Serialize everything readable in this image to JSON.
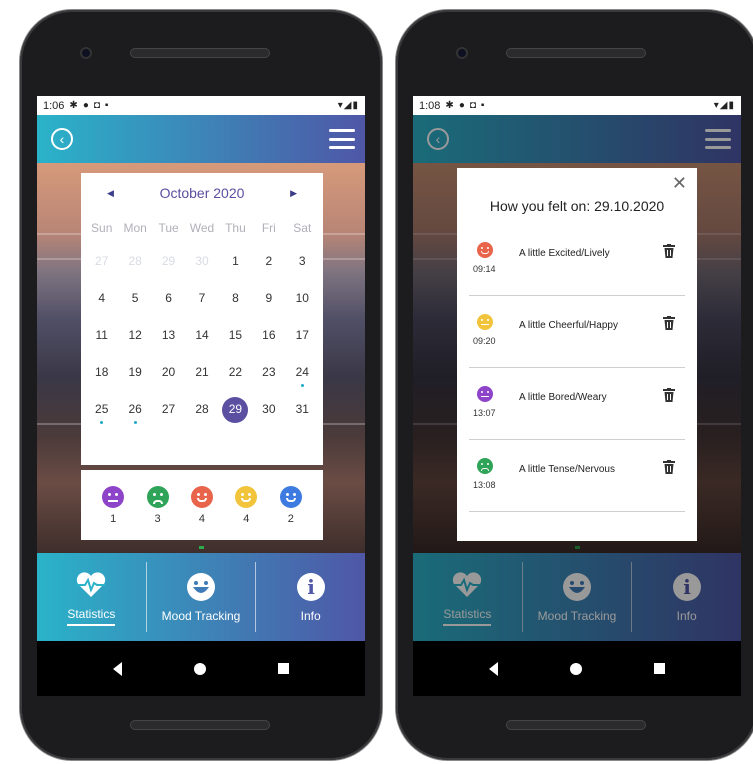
{
  "colors": {
    "accent": "#5a4fa0",
    "gradient_start": "#2ab3c9",
    "gradient_end": "#4f57a6",
    "mood_bored": "#8e44c9",
    "mood_tense": "#2fa358",
    "mood_excited": "#e8644a",
    "mood_cheerful": "#f2c43c",
    "mood_calm": "#3d7be0",
    "event_dot": "#22a8c9"
  },
  "left_screen": {
    "status_time": "1:06",
    "calendar": {
      "month_label": "October 2020",
      "prev_icon": "chevron-left-icon",
      "next_icon": "chevron-right-icon",
      "weekdays": [
        "Sun",
        "Mon",
        "Tue",
        "Wed",
        "Thu",
        "Fri",
        "Sat"
      ],
      "days": [
        {
          "n": "27",
          "muted": true
        },
        {
          "n": "28",
          "muted": true
        },
        {
          "n": "29",
          "muted": true
        },
        {
          "n": "30",
          "muted": true
        },
        {
          "n": "1"
        },
        {
          "n": "2"
        },
        {
          "n": "3"
        },
        {
          "n": "4"
        },
        {
          "n": "5"
        },
        {
          "n": "6"
        },
        {
          "n": "7"
        },
        {
          "n": "8"
        },
        {
          "n": "9"
        },
        {
          "n": "10"
        },
        {
          "n": "11"
        },
        {
          "n": "12"
        },
        {
          "n": "13"
        },
        {
          "n": "14"
        },
        {
          "n": "15"
        },
        {
          "n": "16"
        },
        {
          "n": "17"
        },
        {
          "n": "18"
        },
        {
          "n": "19"
        },
        {
          "n": "20"
        },
        {
          "n": "21"
        },
        {
          "n": "22"
        },
        {
          "n": "23"
        },
        {
          "n": "24",
          "dot": true
        },
        {
          "n": "25",
          "dot": true
        },
        {
          "n": "26",
          "dot": true
        },
        {
          "n": "27"
        },
        {
          "n": "28"
        },
        {
          "n": "29",
          "selected": true
        },
        {
          "n": "30"
        },
        {
          "n": "31"
        }
      ]
    },
    "mood_summary": [
      {
        "mood": "bored",
        "face": "flat",
        "color": "#8e44c9",
        "count": "1"
      },
      {
        "mood": "tense",
        "face": "sad",
        "color": "#2fa358",
        "count": "3"
      },
      {
        "mood": "excited",
        "face": "happy",
        "color": "#e8644a",
        "count": "4"
      },
      {
        "mood": "cheerful",
        "face": "happy",
        "color": "#f2c43c",
        "count": "4"
      },
      {
        "mood": "calm",
        "face": "happy",
        "color": "#3d7be0",
        "count": "2"
      }
    ]
  },
  "right_screen": {
    "status_time": "1:08",
    "dialog": {
      "title": "How you felt on: 29.10.2020",
      "entries": [
        {
          "time": "09:14",
          "label": "A little Excited/Lively",
          "face": "happy",
          "color": "#e8644a"
        },
        {
          "time": "09:20",
          "label": "A little Cheerful/Happy",
          "face": "flat",
          "color": "#f2c43c"
        },
        {
          "time": "13:07",
          "label": "A little Bored/Weary",
          "face": "flat",
          "color": "#8e44c9"
        },
        {
          "time": "13:08",
          "label": "A little Tense/Nervous",
          "face": "sad",
          "color": "#2fa358"
        }
      ]
    }
  },
  "bottom_nav": {
    "statistics": "Statistics",
    "mood_tracking": "Mood Tracking",
    "info": "Info",
    "statistics_icon": "heartbeat-icon",
    "mood_icon": "smiley-icon",
    "info_icon": "info-icon"
  }
}
